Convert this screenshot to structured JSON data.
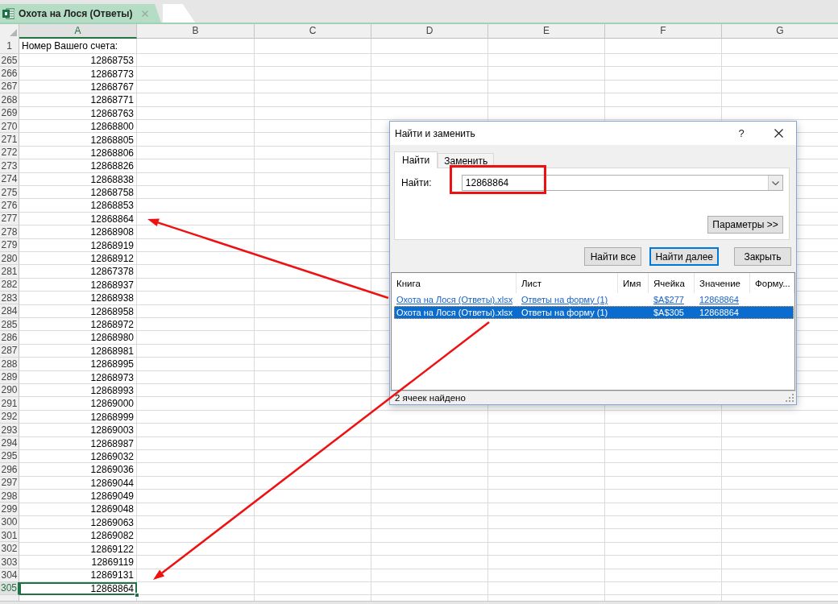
{
  "tabs": [
    {
      "label": "Охота на Лося (Ответы)",
      "selected": true
    }
  ],
  "sheet": {
    "columns": [
      {
        "label": "A",
        "selected": true
      },
      {
        "label": "B",
        "selected": false
      },
      {
        "label": "C",
        "selected": false
      },
      {
        "label": "D",
        "selected": false
      },
      {
        "label": "E",
        "selected": false
      },
      {
        "label": "F",
        "selected": false
      },
      {
        "label": "G",
        "selected": false
      }
    ],
    "rows": [
      {
        "number": "1",
        "value": "Номер Вашего счета:",
        "kind": "text",
        "selected": false
      },
      {
        "number": "265",
        "value": "12868753",
        "kind": "number",
        "selected": false
      },
      {
        "number": "266",
        "value": "12868773",
        "kind": "number",
        "selected": false
      },
      {
        "number": "267",
        "value": "12868767",
        "kind": "number",
        "selected": false
      },
      {
        "number": "268",
        "value": "12868771",
        "kind": "number",
        "selected": false
      },
      {
        "number": "269",
        "value": "12868763",
        "kind": "number",
        "selected": false
      },
      {
        "number": "270",
        "value": "12868800",
        "kind": "number",
        "selected": false
      },
      {
        "number": "271",
        "value": "12868805",
        "kind": "number",
        "selected": false
      },
      {
        "number": "272",
        "value": "12868806",
        "kind": "number",
        "selected": false
      },
      {
        "number": "273",
        "value": "12868826",
        "kind": "number",
        "selected": false
      },
      {
        "number": "274",
        "value": "12868838",
        "kind": "number",
        "selected": false
      },
      {
        "number": "275",
        "value": "12868758",
        "kind": "number",
        "selected": false
      },
      {
        "number": "276",
        "value": "12868853",
        "kind": "number",
        "selected": false
      },
      {
        "number": "277",
        "value": "12868864",
        "kind": "number",
        "selected": false
      },
      {
        "number": "278",
        "value": "12868908",
        "kind": "number",
        "selected": false
      },
      {
        "number": "279",
        "value": "12868919",
        "kind": "number",
        "selected": false
      },
      {
        "number": "280",
        "value": "12868912",
        "kind": "number",
        "selected": false
      },
      {
        "number": "281",
        "value": "12867378",
        "kind": "number",
        "selected": false
      },
      {
        "number": "282",
        "value": "12868937",
        "kind": "number",
        "selected": false
      },
      {
        "number": "283",
        "value": "12868938",
        "kind": "number",
        "selected": false
      },
      {
        "number": "284",
        "value": "12868958",
        "kind": "number",
        "selected": false
      },
      {
        "number": "285",
        "value": "12868972",
        "kind": "number",
        "selected": false
      },
      {
        "number": "286",
        "value": "12868980",
        "kind": "number",
        "selected": false
      },
      {
        "number": "287",
        "value": "12868981",
        "kind": "number",
        "selected": false
      },
      {
        "number": "288",
        "value": "12868995",
        "kind": "number",
        "selected": false
      },
      {
        "number": "289",
        "value": "12868973",
        "kind": "number",
        "selected": false
      },
      {
        "number": "290",
        "value": "12868993",
        "kind": "number",
        "selected": false
      },
      {
        "number": "291",
        "value": "12869000",
        "kind": "number",
        "selected": false
      },
      {
        "number": "292",
        "value": "12868999",
        "kind": "number",
        "selected": false
      },
      {
        "number": "293",
        "value": "12869003",
        "kind": "number",
        "selected": false
      },
      {
        "number": "294",
        "value": "12868987",
        "kind": "number",
        "selected": false
      },
      {
        "number": "295",
        "value": "12869032",
        "kind": "number",
        "selected": false
      },
      {
        "number": "296",
        "value": "12869036",
        "kind": "number",
        "selected": false
      },
      {
        "number": "297",
        "value": "12869044",
        "kind": "number",
        "selected": false
      },
      {
        "number": "298",
        "value": "12869049",
        "kind": "number",
        "selected": false
      },
      {
        "number": "299",
        "value": "12869048",
        "kind": "number",
        "selected": false
      },
      {
        "number": "300",
        "value": "12869063",
        "kind": "number",
        "selected": false
      },
      {
        "number": "301",
        "value": "12869082",
        "kind": "number",
        "selected": false
      },
      {
        "number": "302",
        "value": "12869122",
        "kind": "number",
        "selected": false
      },
      {
        "number": "303",
        "value": "12869119",
        "kind": "number",
        "selected": false
      },
      {
        "number": "304",
        "value": "12869131",
        "kind": "number",
        "selected": false
      },
      {
        "number": "305",
        "value": "12868864",
        "kind": "number",
        "selected": true
      }
    ]
  },
  "dialog": {
    "title": "Найти и заменить",
    "help": "?",
    "tabs": [
      {
        "label": "Найти",
        "selected": true
      },
      {
        "label": "Заменить",
        "selected": false
      }
    ],
    "find": {
      "label": "Найти:",
      "value": "12868864"
    },
    "options_button": "Параметры >>",
    "buttons": [
      {
        "label": "Найти все",
        "default": false
      },
      {
        "label": "Найти далее",
        "default": true
      },
      {
        "label": "Закрыть",
        "default": false
      }
    ],
    "results": {
      "columns": [
        "Книга",
        "Лист",
        "Имя",
        "Ячейка",
        "Значение",
        "Форму..."
      ],
      "rows": [
        {
          "book": "Охота на Лося (Ответы).xlsx",
          "sheet": "Ответы на форму (1)",
          "cell": "$A$277",
          "value": "12868864",
          "selected": false
        },
        {
          "book": "Охота на Лося (Ответы).xlsx",
          "sheet": "Ответы на форму (1)",
          "cell": "$A$305",
          "value": "12868864",
          "selected": true
        }
      ]
    },
    "status": "2 ячеек найдено"
  }
}
